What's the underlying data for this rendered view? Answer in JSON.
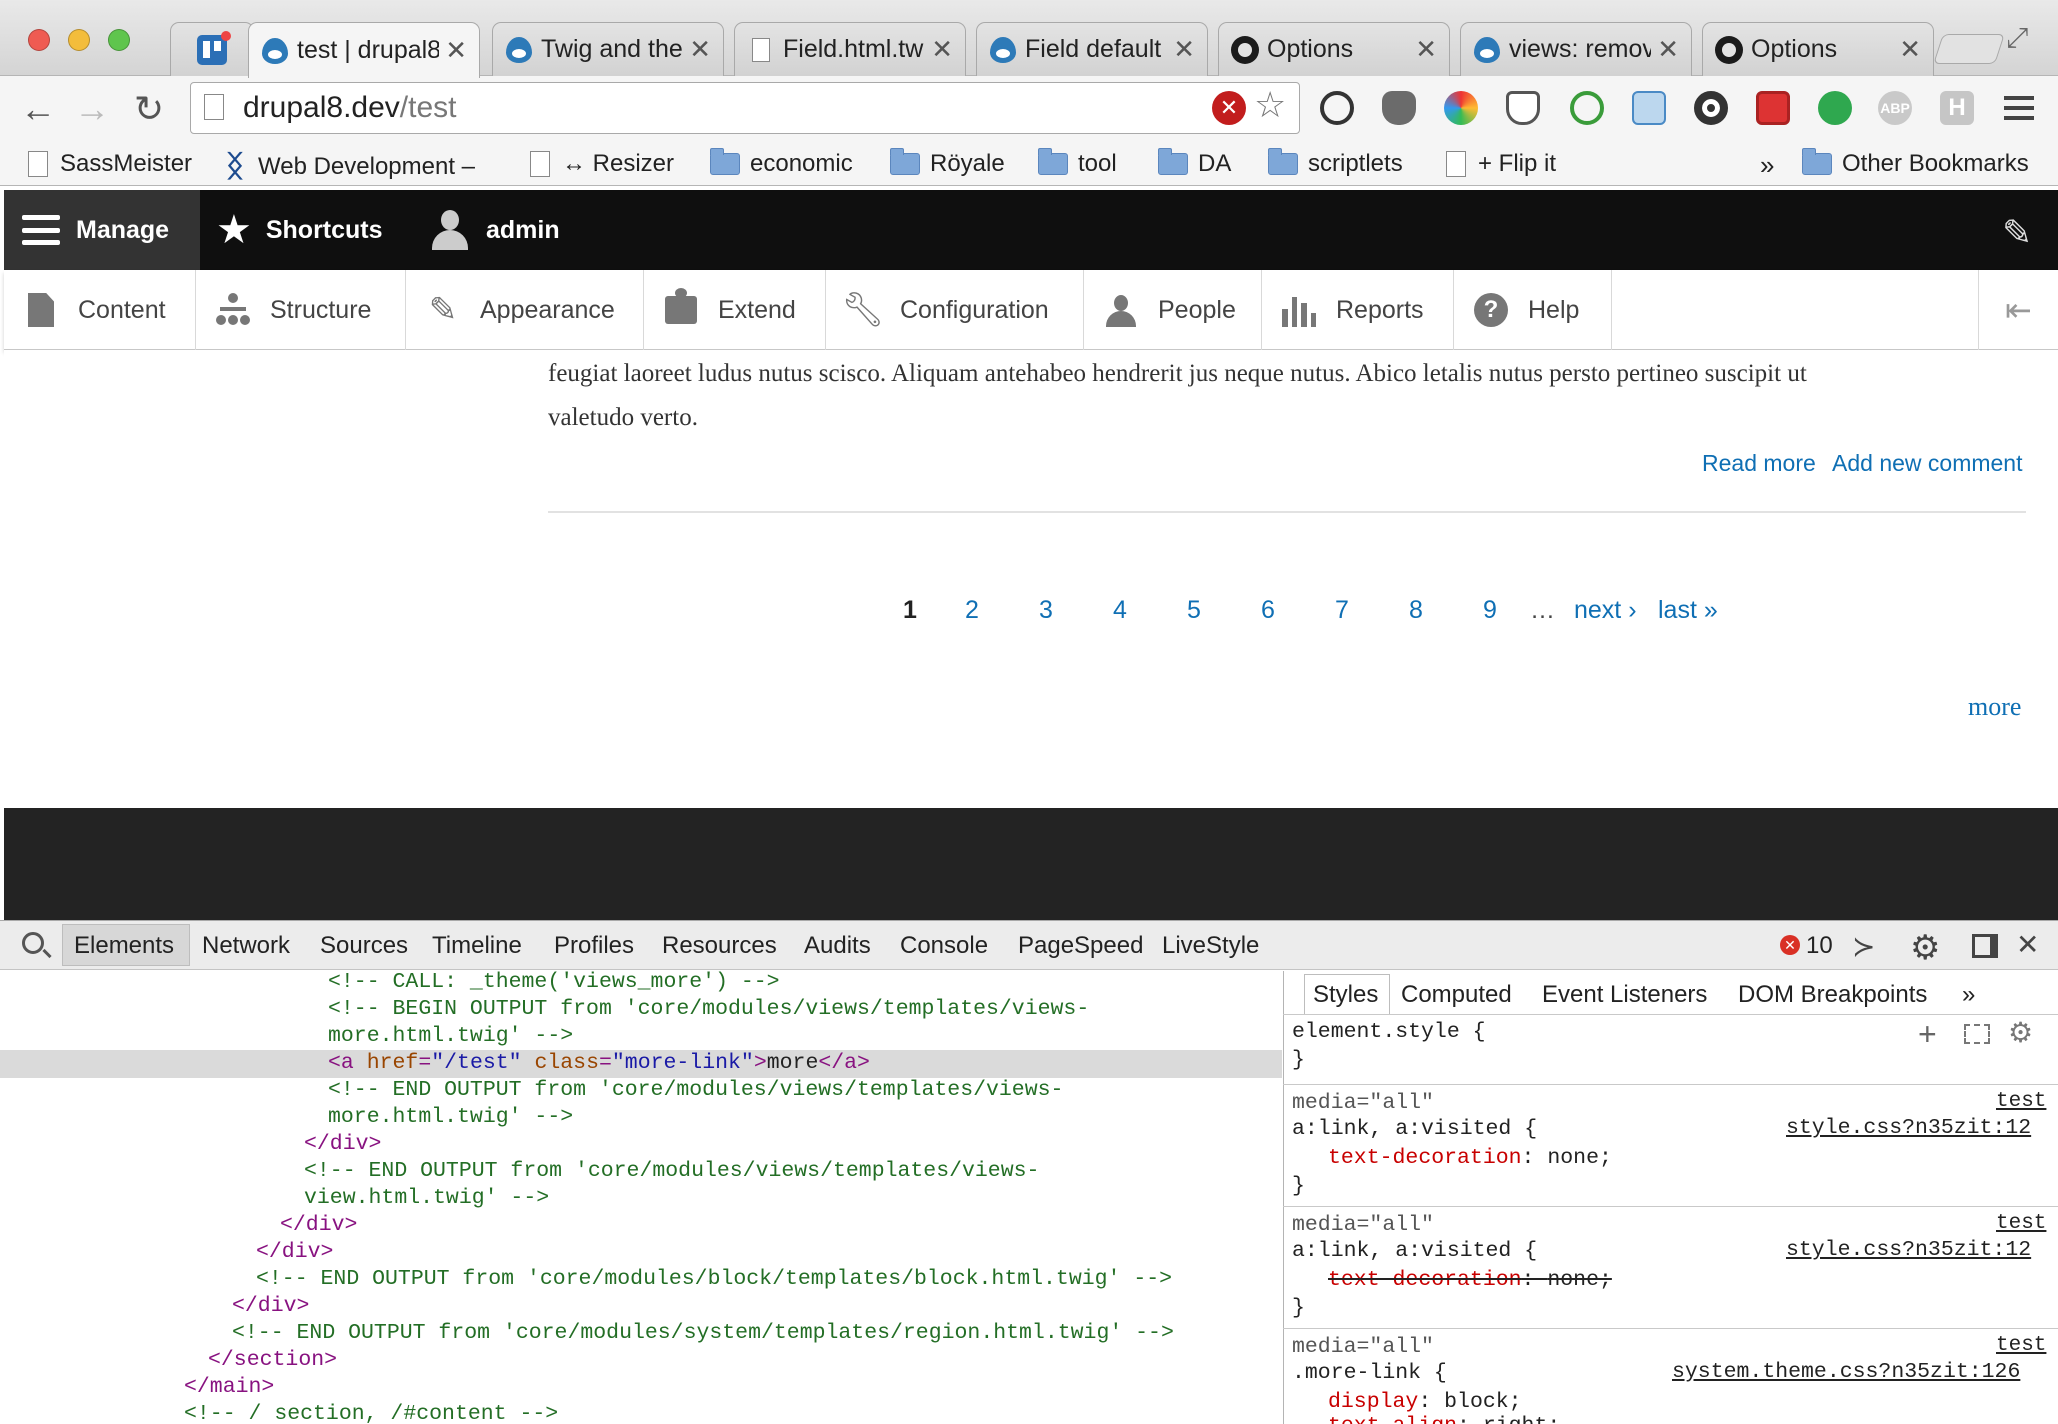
{
  "tabs": [
    {
      "title": "test | drupal8",
      "icon": "drupal-icon",
      "active": true
    },
    {
      "title": "Twig and the",
      "icon": "drupal-icon"
    },
    {
      "title": "Field.html.tw",
      "icon": "page-icon"
    },
    {
      "title": "Field default",
      "icon": "drupal-icon"
    },
    {
      "title": "Options",
      "icon": "github-icon"
    },
    {
      "title": "views: remov",
      "icon": "drupal-icon"
    },
    {
      "title": "Options",
      "icon": "github-icon"
    }
  ],
  "address": {
    "host": "drupal8.dev",
    "path": "/test"
  },
  "bookmarks": [
    "SassMeister",
    "Web Development –",
    "↔ Resizer",
    "economic",
    "Röyale",
    "tool",
    "DA",
    "scriptlets",
    "+ Flip it",
    "»",
    "Other Bookmarks"
  ],
  "admin_toolbar": {
    "manage": "Manage",
    "shortcuts": "Shortcuts",
    "user": "admin"
  },
  "tray": [
    "Content",
    "Structure",
    "Appearance",
    "Extend",
    "Configuration",
    "People",
    "Reports",
    "Help"
  ],
  "content": {
    "body_line1": "feugiat laoreet ludus nutus scisco. Aliquam antehabeo hendrerit jus neque nutus. Abico letalis nutus persto pertineo suscipit ut",
    "body_line2": "valetudo verto.",
    "read_more": "Read more",
    "add_comment": "Add new comment",
    "pager": [
      "1",
      "2",
      "3",
      "4",
      "5",
      "6",
      "7",
      "8",
      "9",
      "…",
      "next ›",
      "last »"
    ],
    "more": "more"
  },
  "devtools": {
    "tabs": [
      "Elements",
      "Network",
      "Sources",
      "Timeline",
      "Profiles",
      "Resources",
      "Audits",
      "Console",
      "PageSpeed",
      "LiveStyle"
    ],
    "error_count": "10",
    "code": {
      "l1": "<!-- CALL: _theme('views_more') -->",
      "l2a": "<!-- BEGIN OUTPUT from 'core/modules/views/templates/views-",
      "l2b": "more.html.twig' -->",
      "l3_tag_open": "<a",
      "l3_attr1": "href",
      "l3_val1": "\"/test\"",
      "l3_attr2": "class",
      "l3_val2": "\"more-link\"",
      "l3_text": "more",
      "l3_tag_close": "</a>",
      "l4a": "<!-- END OUTPUT from 'core/modules/views/templates/views-",
      "l4b": "more.html.twig' -->",
      "l5": "</div>",
      "l6a": "<!-- END OUTPUT from 'core/modules/views/templates/views-",
      "l6b": "view.html.twig' -->",
      "l7": "</div>",
      "l8": "</div>",
      "l9": "<!-- END OUTPUT from 'core/modules/block/templates/block.html.twig' -->",
      "l10": "</div>",
      "l11": "<!-- END OUTPUT from 'core/modules/system/templates/region.html.twig' -->",
      "l12": "</section>",
      "l13": "</main>",
      "l14": "<!-- / section, /#content -->"
    },
    "styles_tabs": [
      "Styles",
      "Computed",
      "Event Listeners",
      "DOM Breakpoints",
      "»"
    ],
    "styles": {
      "element_style": "element.style {",
      "close": "}",
      "rules": [
        {
          "media": "media=\"all\"",
          "origin": "test",
          "selector": "a:link, a:visited {",
          "source": "style.css?n35zit:12",
          "prop": "text-decoration",
          "value": "none;"
        },
        {
          "media": "media=\"all\"",
          "origin": "test",
          "selector": "a:link, a:visited {",
          "source": "style.css?n35zit:12",
          "prop": "text-decoration",
          "value": "none;"
        },
        {
          "media": "media=\"all\"",
          "origin": "test",
          "selector": ".more-link {",
          "source": "system.theme.css?n35zit:126",
          "prop": "display",
          "value": "block;",
          "prop2": "text-align",
          "value2": "right;"
        }
      ]
    }
  }
}
